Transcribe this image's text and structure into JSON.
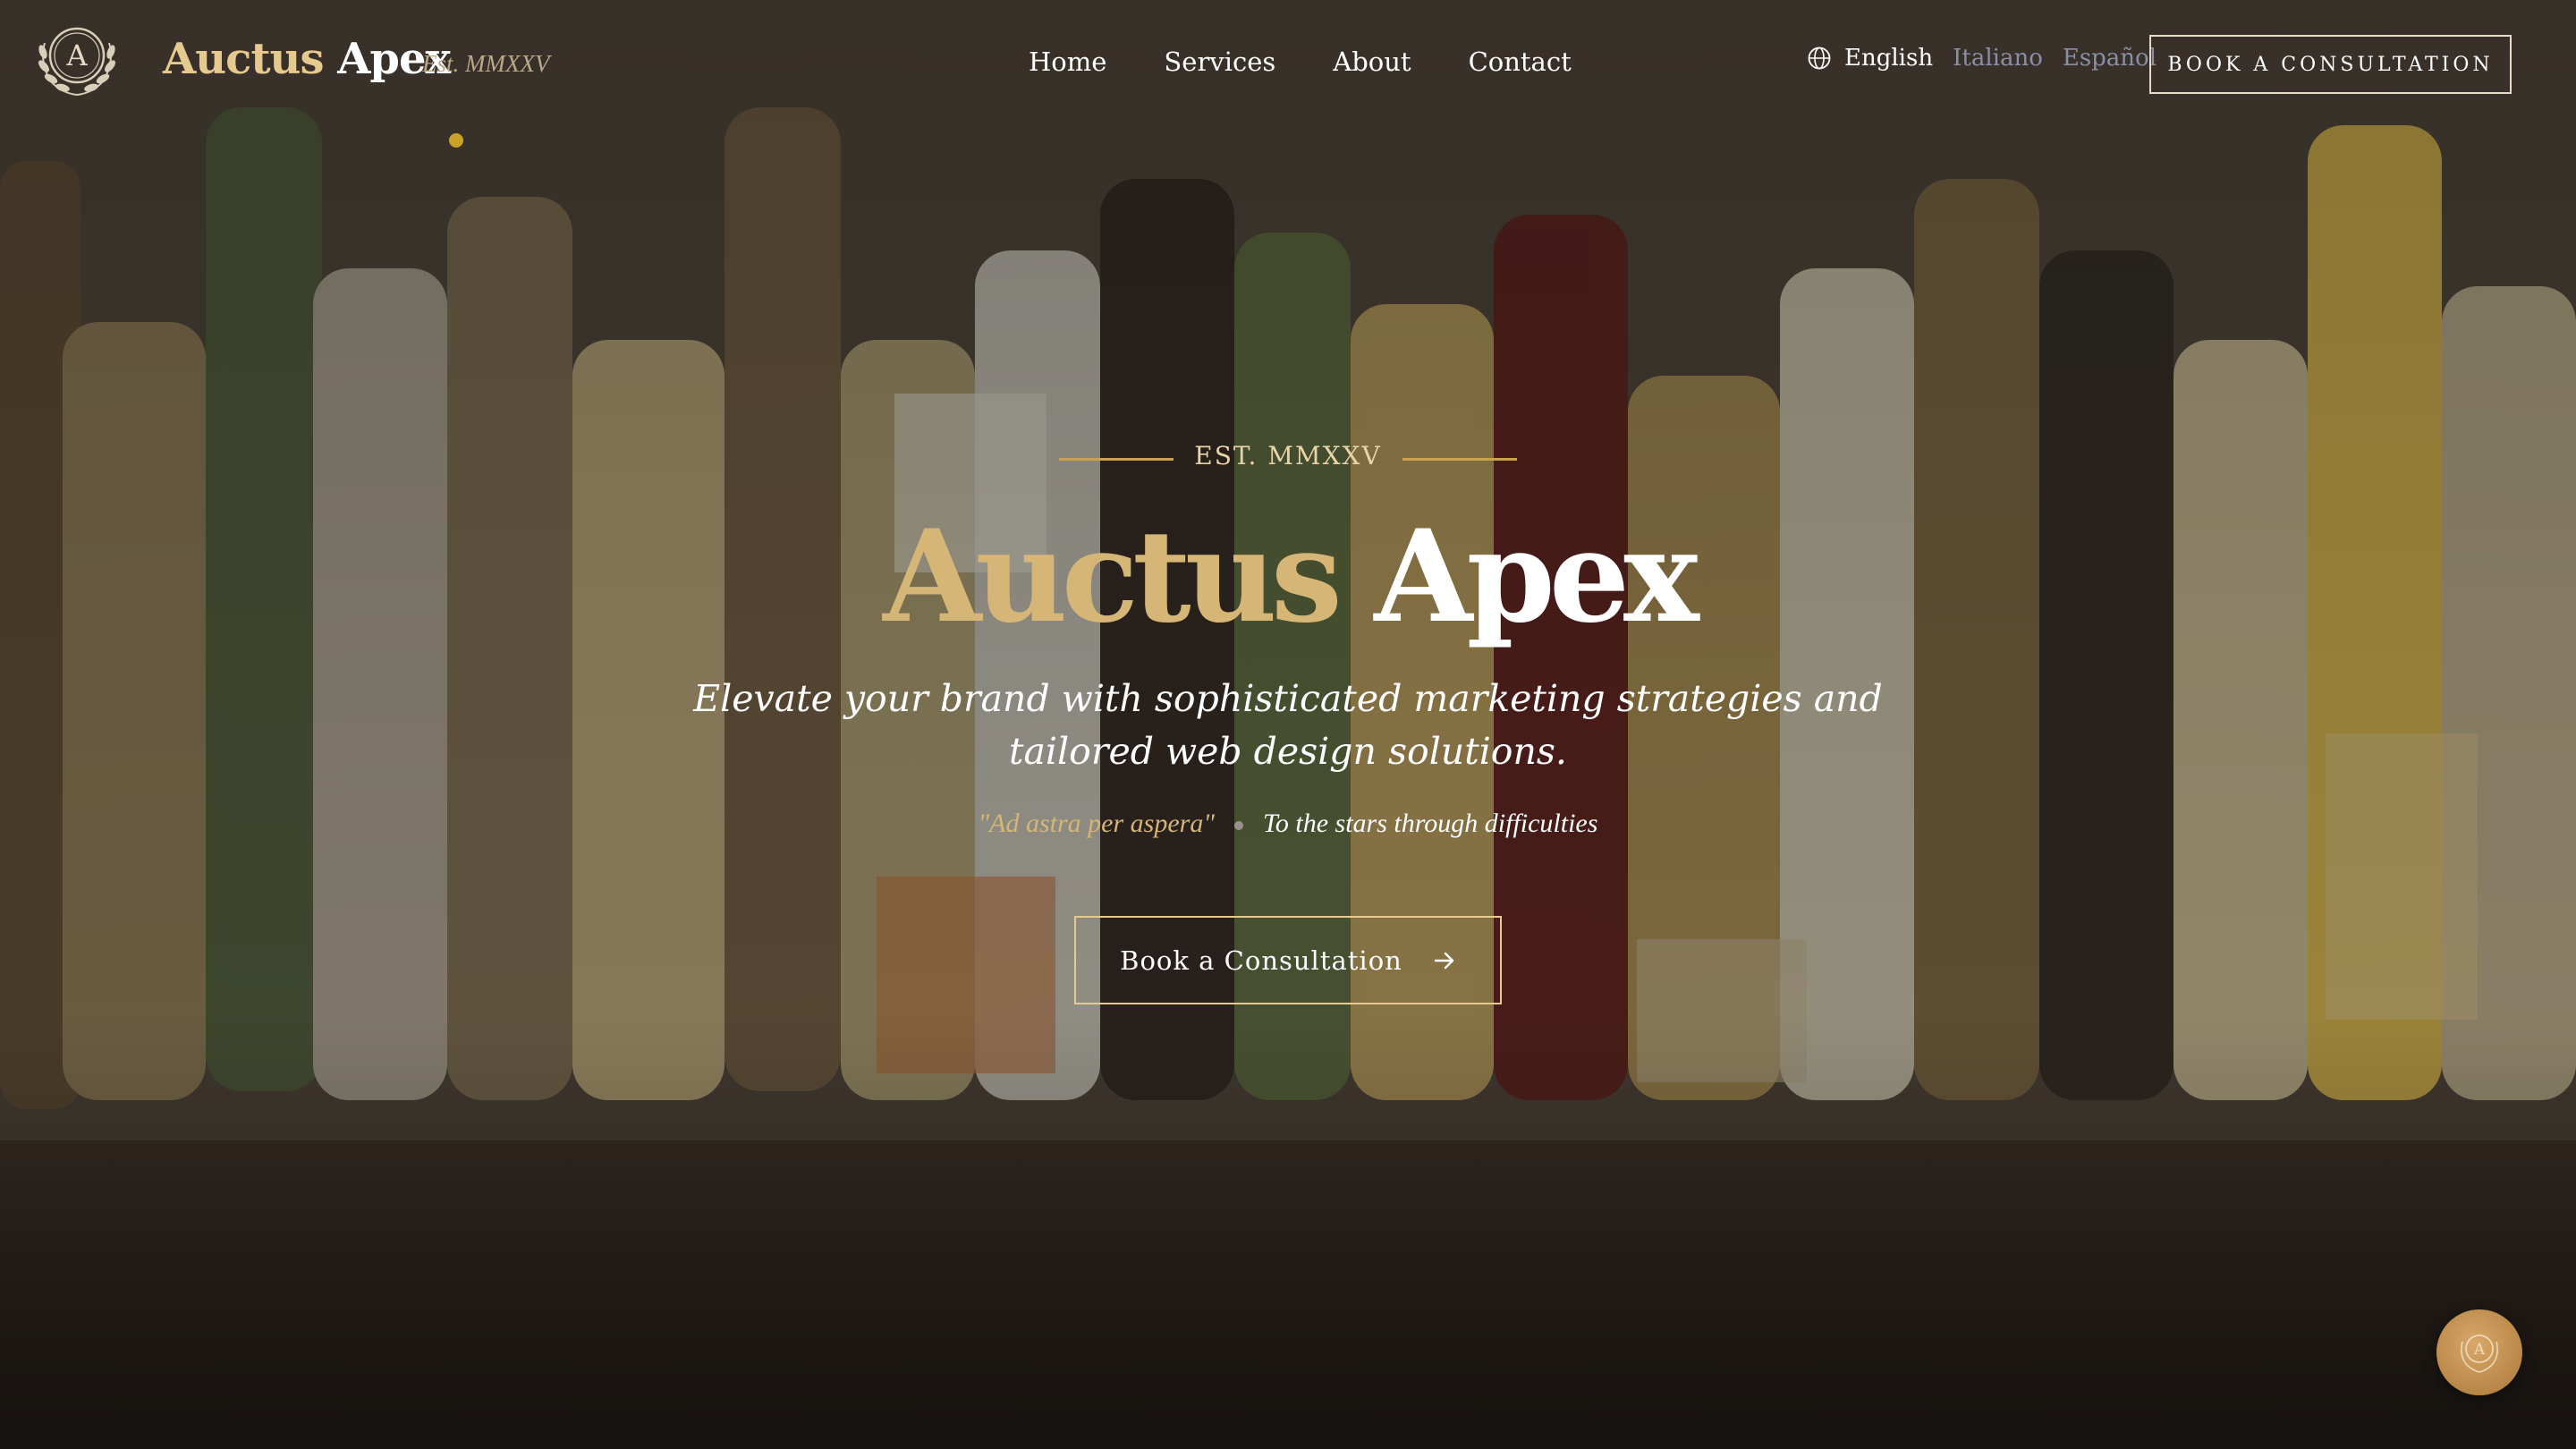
{
  "brand": {
    "name_part1": "Auctus",
    "name_part2": "Apex",
    "tagline": "Est. MMXXV"
  },
  "nav": {
    "items": [
      {
        "label": "Home"
      },
      {
        "label": "Services"
      },
      {
        "label": "About"
      },
      {
        "label": "Contact"
      }
    ]
  },
  "language": {
    "icon": "globe-icon",
    "options": [
      {
        "label": "English",
        "active": true
      },
      {
        "label": "Italiano",
        "active": false
      },
      {
        "label": "Español",
        "active": false
      }
    ]
  },
  "header_cta": {
    "label": "BOOK A CONSULTATION"
  },
  "hero": {
    "est": "EST. MMXXV",
    "title_part1": "Auctus",
    "title_part2": "Apex",
    "subtitle_line1": "Elevate your brand with sophisticated marketing strategies and",
    "subtitle_line2": "tailored web design solutions.",
    "motto_latin": "\"Ad astra per aspera\"",
    "motto_translation": "To the stars through difficulties",
    "cta_label": "Book a Consultation",
    "cta_icon": "arrow-right-icon"
  },
  "floating_button": {
    "icon": "laurel-emblem-icon"
  },
  "colors": {
    "gold": "#d6b677",
    "gold_light": "#e6c98f",
    "accent_dot": "#c9a227",
    "text": "#ffffff",
    "inactive_lang": "#8a8fa6",
    "badge": "#c4924f"
  }
}
